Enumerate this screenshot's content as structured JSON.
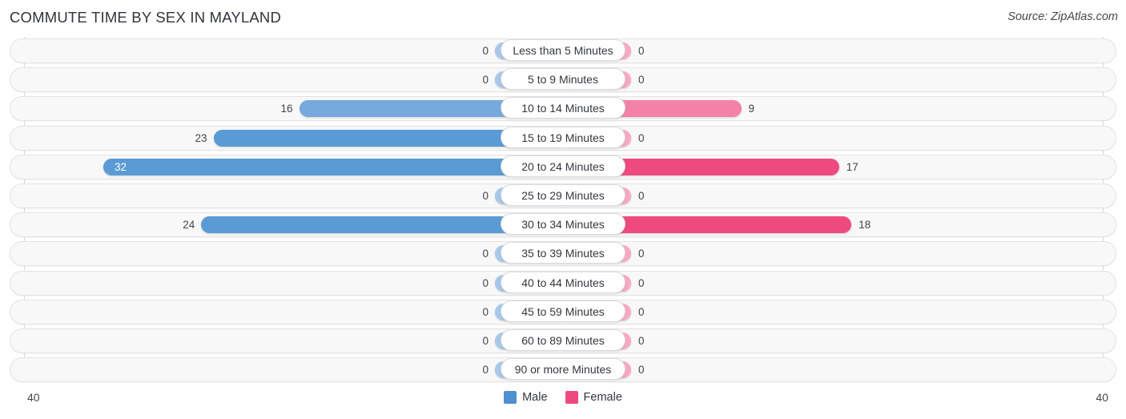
{
  "header": {
    "title": "COMMUTE TIME BY SEX IN MAYLAND",
    "source": "Source: ZipAtlas.com"
  },
  "axis": {
    "left_label": "40",
    "right_label": "40",
    "max": 40
  },
  "legend": {
    "items": [
      {
        "label": "Male",
        "color": "#4f90d0"
      },
      {
        "label": "Female",
        "color": "#ef4a7f"
      }
    ]
  },
  "colors": {
    "male_zero": "#a8c8ea",
    "male_mid": "#76a9dd",
    "male_high": "#5b9bd5",
    "female_zero": "#f9a8c4",
    "female_mid": "#f481a8",
    "female_high": "#ef4a7f",
    "track_fill": "#f8f8f8",
    "track_border": "#e3e3e3",
    "gridline": "#d8d8d8",
    "text": "#41454c"
  },
  "chart_data": {
    "type": "bar",
    "title": "COMMUTE TIME BY SEX IN MAYLAND",
    "subtitle": "Source: ZipAtlas.com",
    "orientation": "horizontal-diverging",
    "xlabel": "",
    "ylabel": "",
    "xlim": [
      40,
      40
    ],
    "grid": true,
    "legend_position": "bottom-center",
    "categories": [
      "Less than 5 Minutes",
      "5 to 9 Minutes",
      "10 to 14 Minutes",
      "15 to 19 Minutes",
      "20 to 24 Minutes",
      "25 to 29 Minutes",
      "30 to 34 Minutes",
      "35 to 39 Minutes",
      "40 to 44 Minutes",
      "45 to 59 Minutes",
      "60 to 89 Minutes",
      "90 or more Minutes"
    ],
    "series": [
      {
        "name": "Male",
        "color": "#4f90d0",
        "side": "left",
        "values": [
          0,
          0,
          16,
          23,
          32,
          0,
          24,
          0,
          0,
          0,
          0,
          0
        ]
      },
      {
        "name": "Female",
        "color": "#ef4a7f",
        "side": "right",
        "values": [
          0,
          0,
          9,
          0,
          17,
          0,
          18,
          0,
          0,
          0,
          0,
          0
        ]
      }
    ]
  }
}
